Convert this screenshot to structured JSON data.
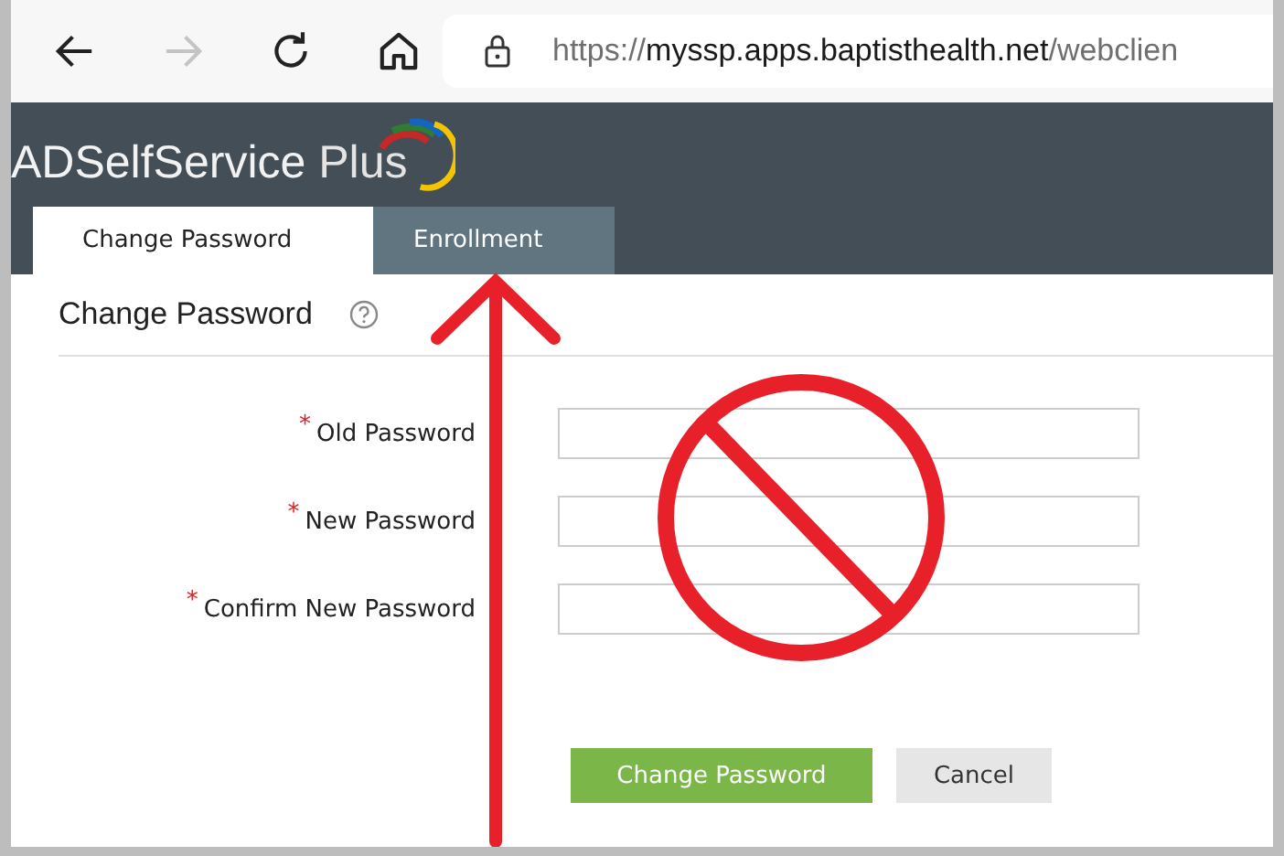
{
  "browser": {
    "nav_buttons": [
      {
        "kind": "back",
        "disabled": false
      },
      {
        "kind": "forward",
        "disabled": true
      },
      {
        "kind": "reload",
        "disabled": false
      },
      {
        "kind": "home",
        "disabled": false
      }
    ],
    "url": {
      "scheme": "https://",
      "host": "myssp.apps.baptisthealth.net",
      "path": "/webclien"
    }
  },
  "app": {
    "logo": {
      "name": "ADSelfService",
      "suffix": "Plus"
    },
    "tabs": [
      {
        "label": "Change Password",
        "selected": true
      },
      {
        "label": "Enrollment",
        "selected": false
      }
    ]
  },
  "form": {
    "heading": "Change Password",
    "fields": [
      {
        "label": "Old Password",
        "required_mark": "*"
      },
      {
        "label": "New Password",
        "required_mark": "*"
      },
      {
        "label": "Confirm New Password",
        "required_mark": "*"
      }
    ],
    "buttons": [
      {
        "label": "Change Password",
        "kind": "primary"
      },
      {
        "label": "Cancel",
        "kind": "secondary"
      }
    ]
  },
  "annotations": {
    "arrow": true,
    "prohibition_sign": true
  }
}
